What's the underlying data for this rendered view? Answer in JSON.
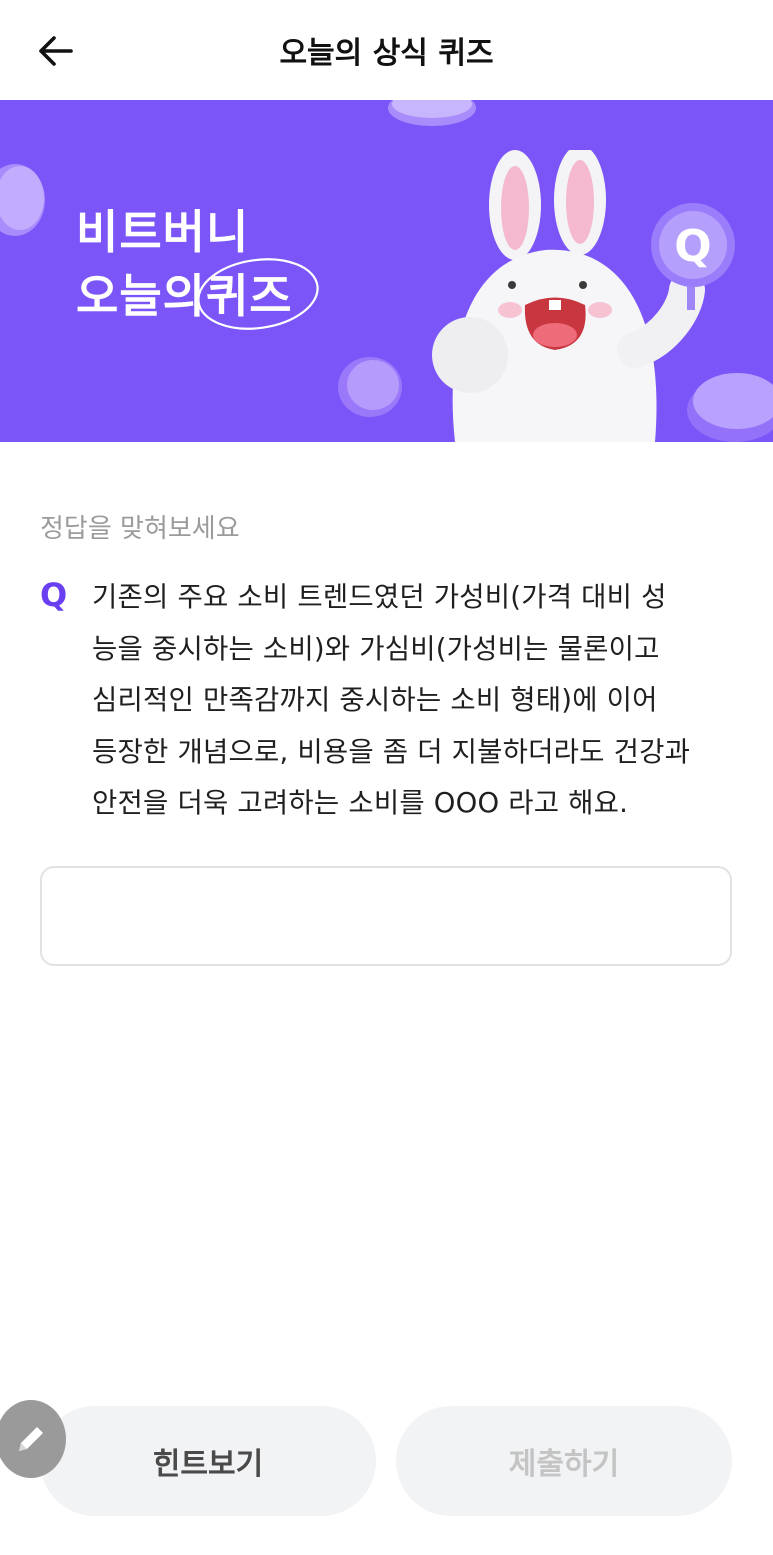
{
  "header": {
    "title": "오늘의 상식 퀴즈"
  },
  "banner": {
    "line1": "비트버니",
    "line2_prefix": "오늘의",
    "line2_circled": "퀴즈",
    "badge_letter": "Q"
  },
  "quiz": {
    "subtitle": "정답을 맞혀보세요",
    "q_mark": "Q",
    "question_lines": [
      "기존의 주요 소비 트렌드였던 가성비(가격 대비 성",
      "능을 중시하는 소비)와 가심비(가성비는 물론이고",
      "심리적인 만족감까지 중시하는 소비 형태)에 이어",
      "등장한 개념으로, 비용을 좀 더 지불하더라도 건강과",
      "안전을 더욱 고려하는 소비를 OOO 라고 해요."
    ],
    "answer_value": "",
    "answer_placeholder": ""
  },
  "buttons": {
    "hint_label": "힌트보기",
    "submit_label": "제출하기"
  },
  "colors": {
    "banner_bg": "#7b55f8",
    "accent": "#6a3ff2",
    "button_bg": "#f2f3f5"
  },
  "icons": {
    "back": "arrow-left-icon",
    "edit": "pencil-icon"
  }
}
